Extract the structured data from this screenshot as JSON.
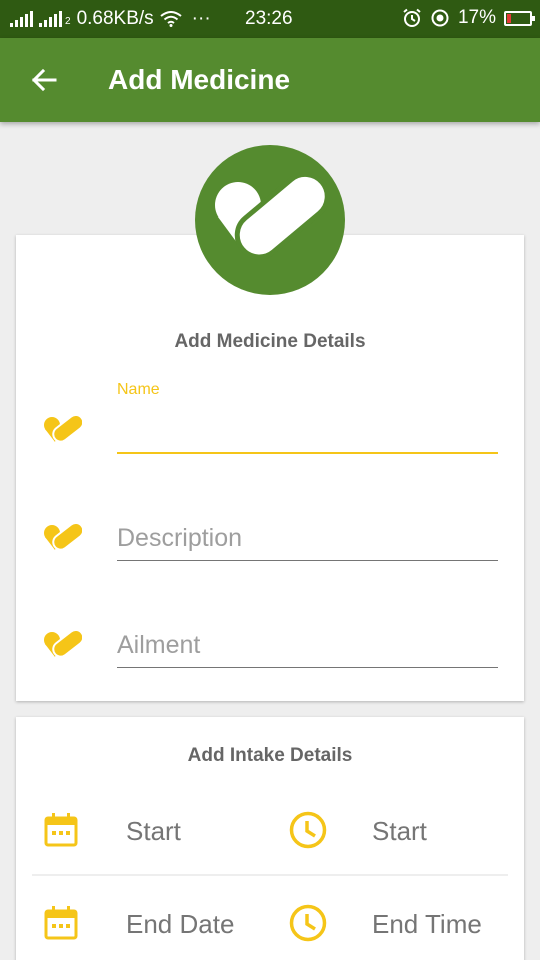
{
  "statusbar": {
    "speed": "0.68KB/s",
    "dots": "···",
    "time": "23:26",
    "battery": "17%",
    "battery_level": 0.17
  },
  "appbar": {
    "title": "Add Medicine"
  },
  "medicine_card": {
    "heading": "Add Medicine Details",
    "name_label": "Name",
    "name_value": "",
    "description_placeholder": "Description",
    "ailment_placeholder": "Ailment"
  },
  "intake_card": {
    "heading": "Add Intake Details",
    "start_date_label": "Start",
    "start_time_label": "Start",
    "end_date_label": "End Date",
    "end_time_label": "End Time"
  },
  "colors": {
    "primary": "#558b2f",
    "primary_dark": "#2f5a12",
    "accent": "#f5c518"
  },
  "icons": {
    "back": "arrow-left-icon",
    "logo": "pill-heart-icon",
    "field": "pill-heart-icon",
    "date": "calendar-icon",
    "time": "clock-icon"
  }
}
